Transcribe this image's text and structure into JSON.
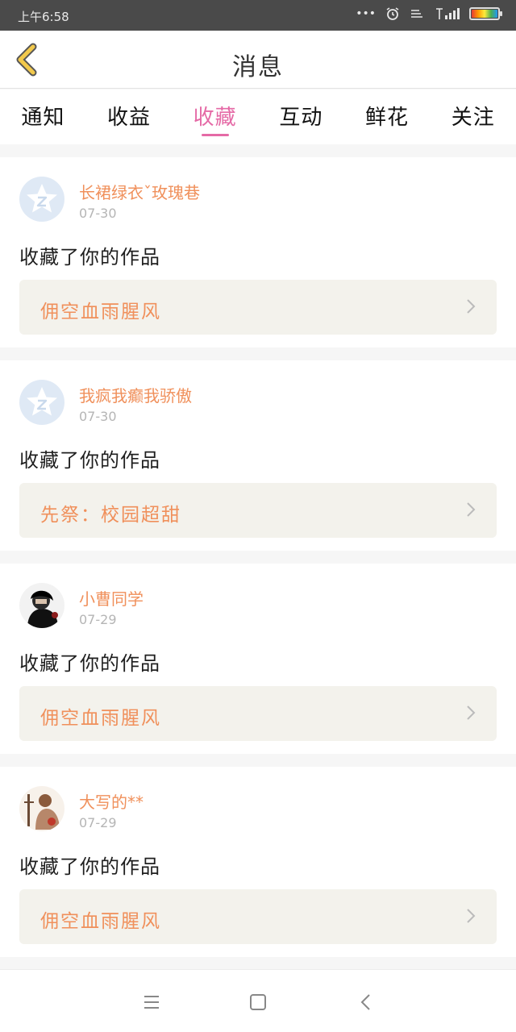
{
  "status_bar": {
    "time": "上午6:58",
    "icons": [
      "more-dots-icon",
      "alarm-icon",
      "data-icon",
      "signal-icon",
      "battery-icon"
    ],
    "battery_colors": [
      "#e53935",
      "#ff9800",
      "#ffeb3b",
      "#4caf50",
      "#2196f3"
    ]
  },
  "header": {
    "title": "消息",
    "back_icon": "chevron-left-icon"
  },
  "tabs": [
    {
      "label": "通知",
      "active": false
    },
    {
      "label": "收益",
      "active": false
    },
    {
      "label": "收藏",
      "active": true
    },
    {
      "label": "互动",
      "active": false
    },
    {
      "label": "鲜花",
      "active": false
    },
    {
      "label": "关注",
      "active": false
    }
  ],
  "messages": [
    {
      "user": "长裙绿衣ˇ玫瑰巷",
      "date": "07-30",
      "action": "收藏了你的作品",
      "work": "佣空血雨腥风",
      "avatar": "default-avatar"
    },
    {
      "user": "我疯我癫我骄傲",
      "date": "07-30",
      "action": "收藏了你的作品",
      "work": "先祭：校园超甜",
      "avatar": "default-avatar"
    },
    {
      "user": "小曹同学",
      "date": "07-29",
      "action": "收藏了你的作品",
      "work": "佣空血雨腥风",
      "avatar": "photo-avatar-dark"
    },
    {
      "user": "大写的**",
      "date": "07-29",
      "action": "收藏了你的作品",
      "work": "佣空血雨腥风",
      "avatar": "photo-avatar-illustration"
    }
  ],
  "colors": {
    "accent_pink": "#e56aa6",
    "username_orange": "#f0905b",
    "work_bg": "#f3f2ec",
    "status_bar_bg": "#4a4a4a",
    "back_arrow": "#f2c94c"
  },
  "nav_bar": [
    "menu-icon",
    "home-square-icon",
    "back-icon"
  ]
}
